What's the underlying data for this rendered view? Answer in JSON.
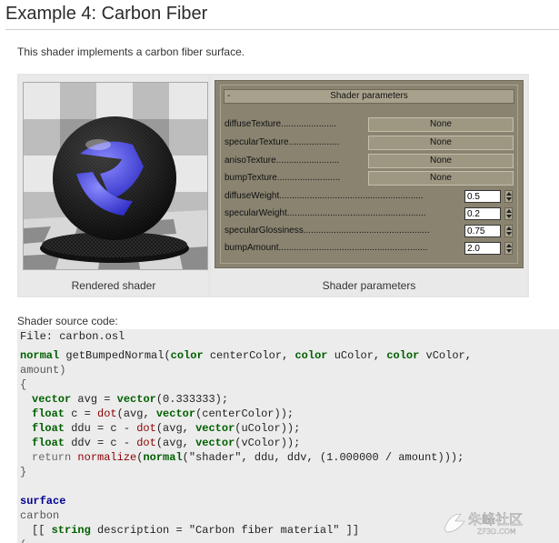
{
  "page": {
    "title": "Example 4: Carbon Fiber",
    "intro": "This shader implements a carbon fiber surface."
  },
  "figure": {
    "left_caption": "Rendered shader",
    "right_caption": "Shader parameters",
    "panel": {
      "toggle": "-",
      "header": "Shader parameters",
      "map_params": [
        {
          "label": "diffuseTexture......................",
          "value": "None"
        },
        {
          "label": "specularTexture....................",
          "value": "None"
        },
        {
          "label": "anisoTexture.........................",
          "value": "None"
        },
        {
          "label": "bumpTexture.........................",
          "value": "None"
        }
      ],
      "num_params": [
        {
          "label": "diffuseWeight.........................................................",
          "value": "0.5"
        },
        {
          "label": "specularWeight.......................................................",
          "value": "0.2"
        },
        {
          "label": "specularGlossiness..................................................",
          "value": "0.75"
        },
        {
          "label": "bumpAmount...........................................................",
          "value": "2.0"
        }
      ]
    }
  },
  "source": {
    "label": "Shader source code:",
    "file": "File: carbon.osl",
    "code": {
      "l1_kw": "normal",
      "l1_fn": " getBumpedNormal(",
      "l1_t1": "color",
      "l1_a1": " centerColor, ",
      "l1_t2": "color",
      "l1_a2": " uColor, ",
      "l1_t3": "color",
      "l1_a3": " vColor,",
      "l2": "amount)",
      "l3": "{",
      "l4_kw": "vector",
      "l4_a": " avg = ",
      "l4_kw2": "vector",
      "l4_b": "(0.333333);",
      "l5_kw": "float",
      "l5_a": " c = ",
      "l5_fn": "dot",
      "l5_b": "(avg, ",
      "l5_kw2": "vector",
      "l5_c": "(centerColor));",
      "l6_kw": "float",
      "l6_a": " ddu = c - ",
      "l6_fn": "dot",
      "l6_b": "(avg, ",
      "l6_kw2": "vector",
      "l6_c": "(uColor));",
      "l7_kw": "float",
      "l7_a": " ddv = c - ",
      "l7_fn": "dot",
      "l7_b": "(avg, ",
      "l7_kw2": "vector",
      "l7_c": "(vColor));",
      "l8_a": "return ",
      "l8_fn": "normalize",
      "l8_b": "(",
      "l8_kw": "normal",
      "l8_c": "(\"shader\", ddu, ddv, (1.000000 / amount)));",
      "l9": "}",
      "l10": "surface",
      "l11": "carbon",
      "l12_a": "[[ ",
      "l12_kw": "string",
      "l12_b": " description = \"Carbon fiber material\" ]]",
      "l13": "("
    }
  },
  "watermark": {
    "text": "朱峰社区",
    "subtext": "ZF3D.COM"
  },
  "colors": {
    "panel_bg": "#898370",
    "sphere_blue": "#5b5bff",
    "keyword_green": "#006000",
    "keyword_blue": "#000090"
  }
}
